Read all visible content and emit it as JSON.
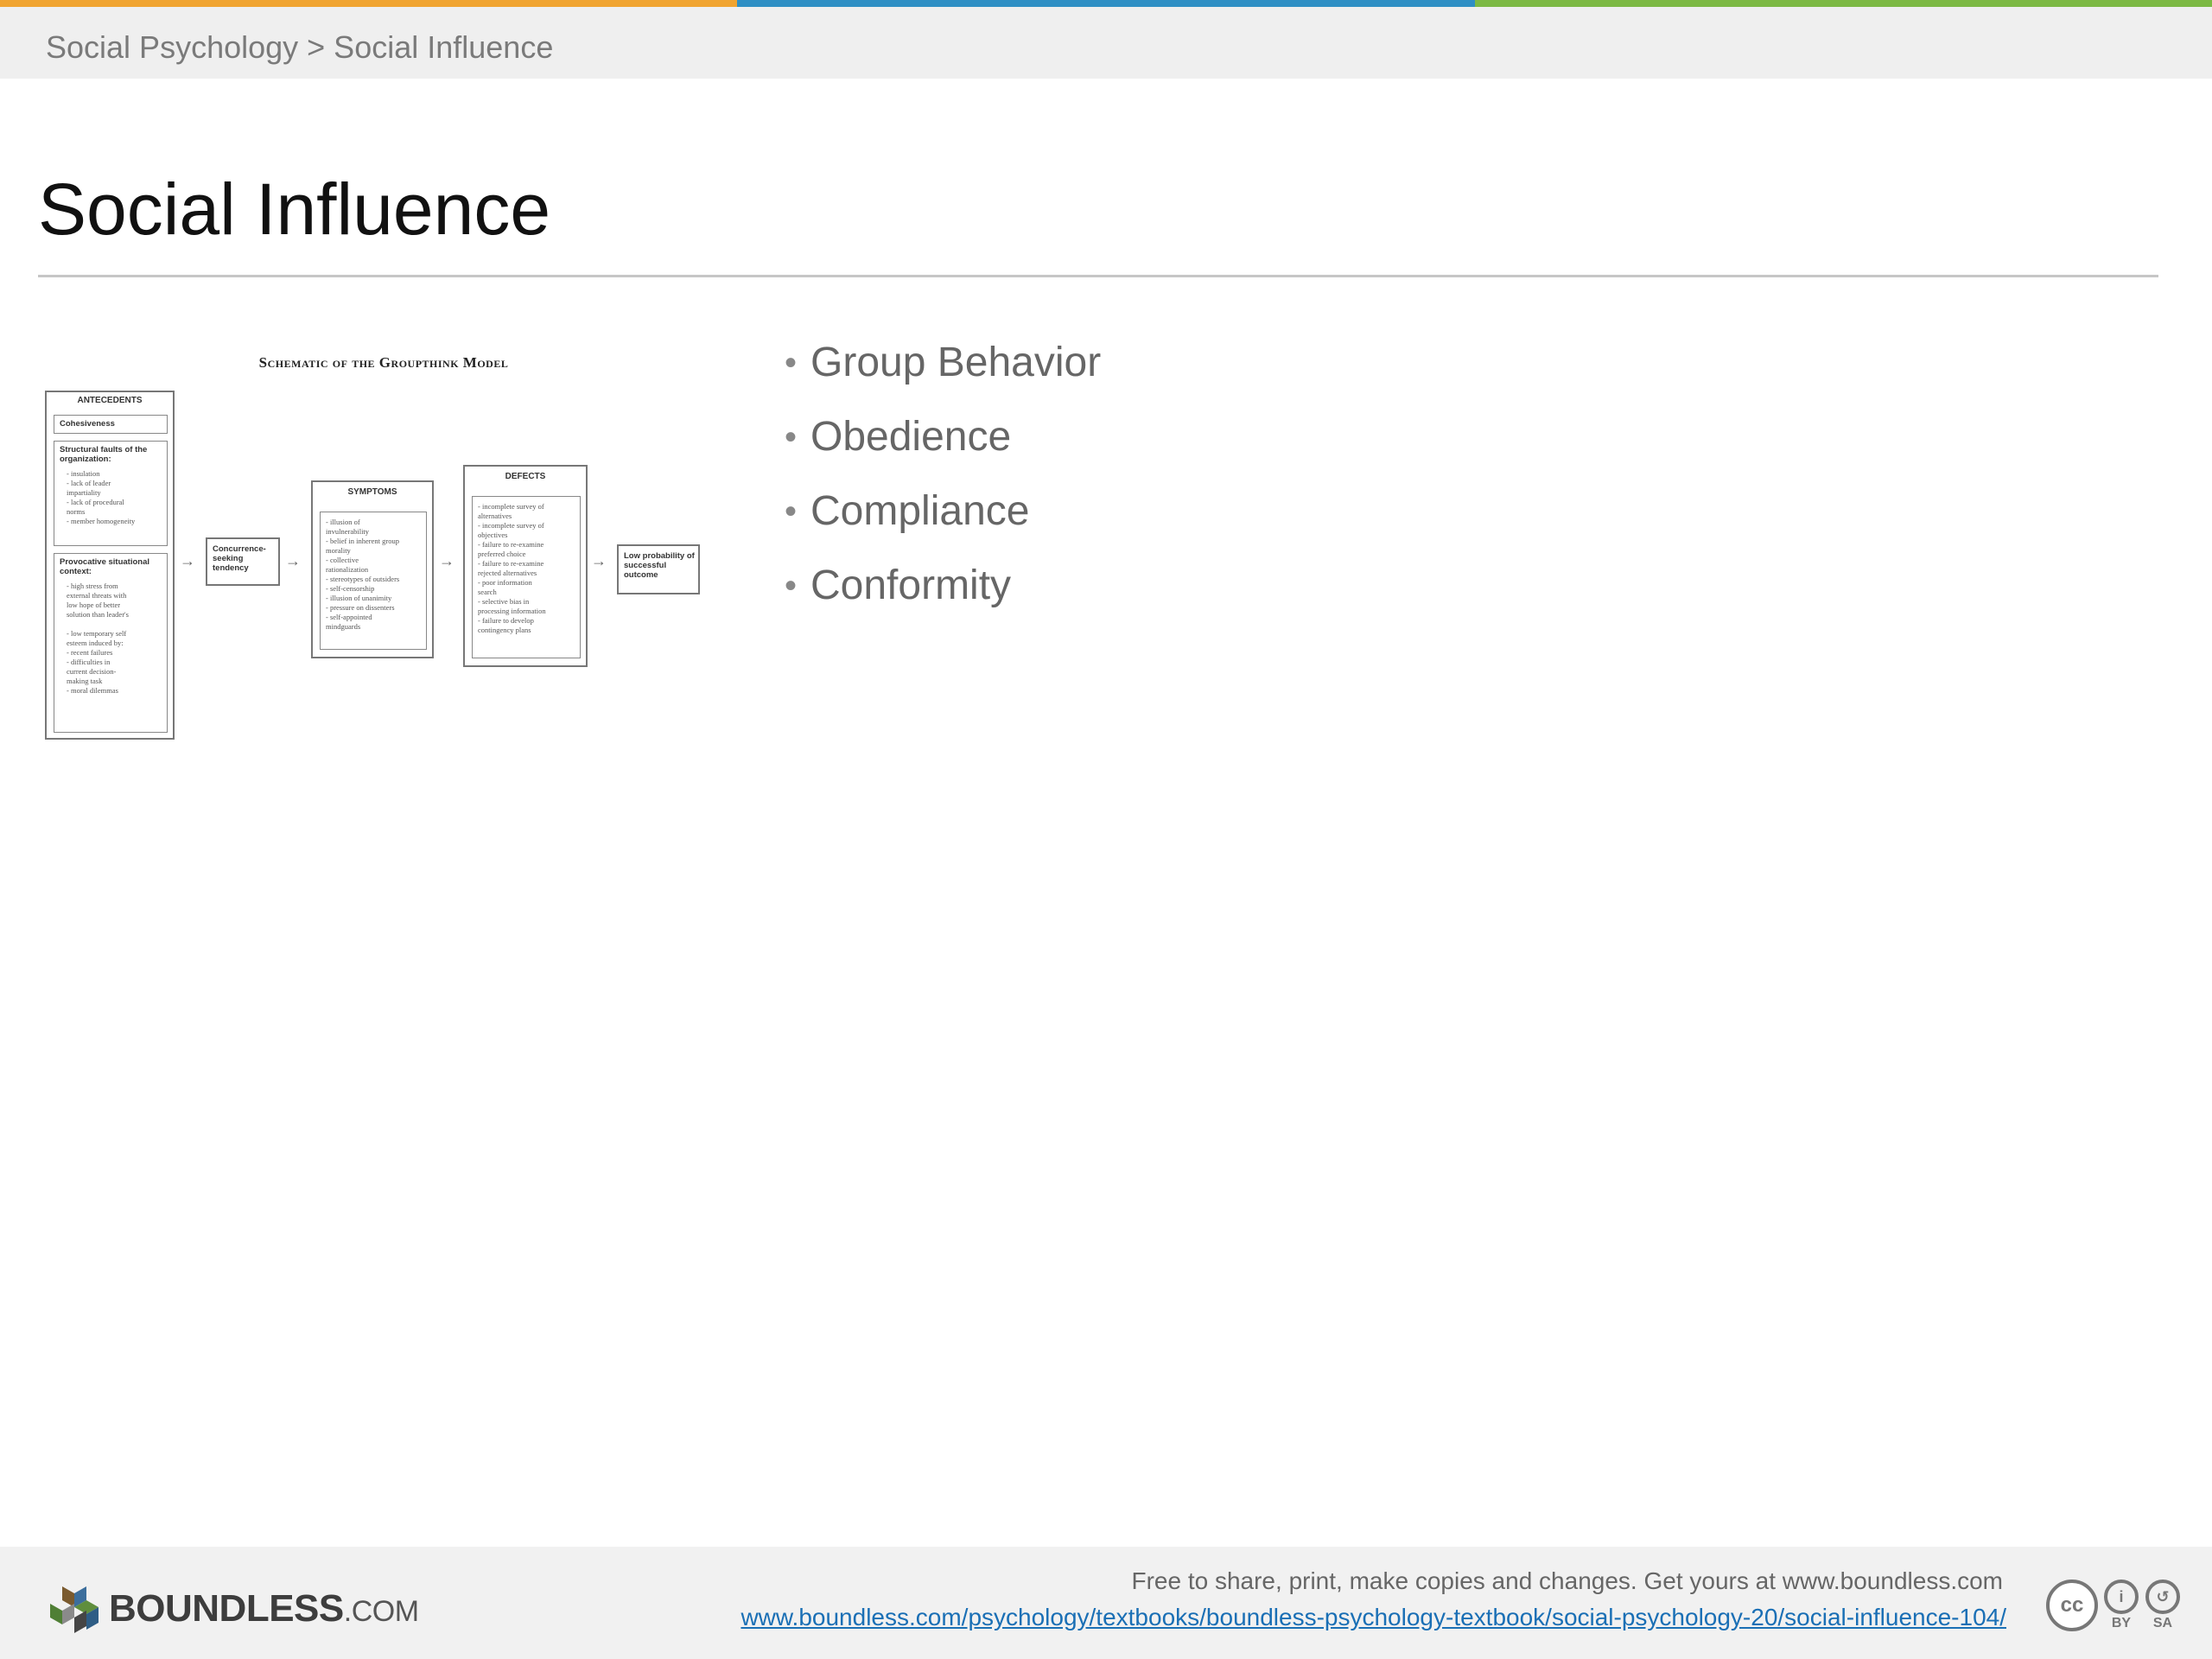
{
  "colors": {
    "bar1": "#f0a431",
    "bar2": "#2e8fc4",
    "bar3": "#7cb944",
    "link": "#1a6fb5"
  },
  "breadcrumb": "Social Psychology > Social Influence",
  "title": "Social Influence",
  "figure": {
    "caption": "Schematic of the Groupthink Model",
    "antecedents": {
      "title": "ANTECEDENTS",
      "cohesiveness": "Cohesiveness",
      "structural_head": "Structural faults of the organization:",
      "structural_items": "- insulation\n- lack of leader\n  impartiality\n- lack of procedural\n  norms\n- member homogeneity",
      "provocative_head": "Provocative situational context:",
      "provocative_items": "- high stress from\n  external threats with\n  low hope of better\n  solution than leader's\n\n- low temporary self\n  esteem induced by:\n   - recent failures\n   - difficulties in\n     current decision-\n     making task\n   - moral dilemmas"
    },
    "tendency": "Concurrence-seeking tendency",
    "symptoms": {
      "title": "SYMPTOMS",
      "items": "- illusion of\n  invulnerability\n- belief in inherent group\n  morality\n- collective\n  rationalization\n- stereotypes of outsiders\n- self-censorship\n- illusion of unanimity\n- pressure on dissenters\n- self-appointed\n  mindguards"
    },
    "defects": {
      "title": "DEFECTS",
      "items": "- incomplete survey of\n  alternatives\n- incomplete survey of\n  objectives\n- failure to re-examine\n  preferred choice\n- failure to re-examine\n  rejected alternatives\n- poor information\n  search\n- selective bias in\n  processing information\n- failure to develop\n  contingency plans"
    },
    "outcome": "Low probability of successful outcome",
    "arrow": "→"
  },
  "bullets": [
    "Group Behavior",
    "Obedience",
    "Compliance",
    "Conformity"
  ],
  "bullet_glyph": "•",
  "footer": {
    "brand": "BOUNDLESS",
    "brand_suffix": ".COM",
    "notice": "Free to share, print, make copies and changes. Get yours at www.boundless.com",
    "url": "www.boundless.com/psychology/textbooks/boundless-psychology-textbook/social-psychology-20/social-influence-104/",
    "cc": "cc",
    "by": "BY",
    "sa": "SA"
  }
}
